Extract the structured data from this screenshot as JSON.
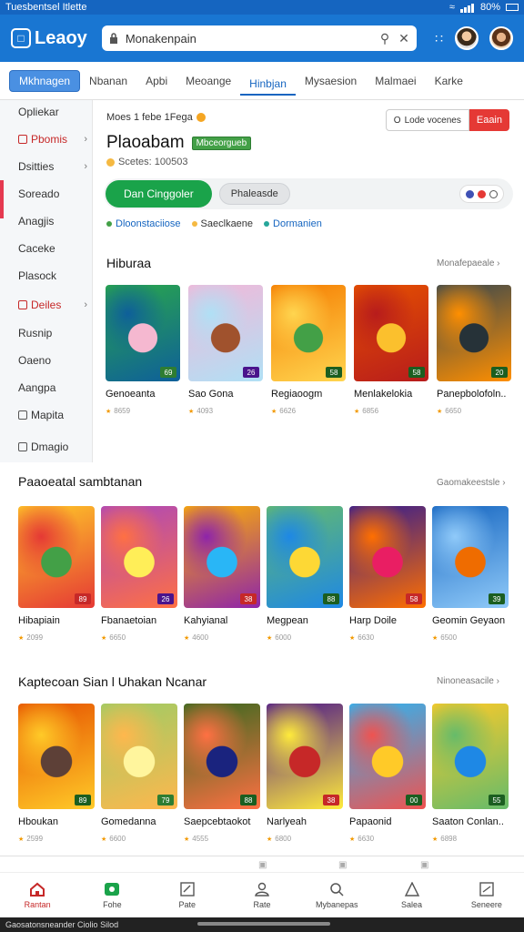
{
  "status_bar": {
    "left_text": "Tuesbentsel Itlette",
    "battery": "80%"
  },
  "header": {
    "logo_text": "Leaoy",
    "search_value": "Monakenpain"
  },
  "tabs": [
    "Mkhnagen",
    "Nbanan",
    "Apbi",
    "Meoange",
    "Hinbjan",
    "Mysaesion",
    "Malmaei",
    "Karke"
  ],
  "sidebar": {
    "items": [
      {
        "label": "Opliekar"
      },
      {
        "label": "Pbomis"
      },
      {
        "label": "Dsitties"
      },
      {
        "label": "Soreado"
      },
      {
        "label": "Anagjis"
      },
      {
        "label": "Caceke"
      },
      {
        "label": "Plasock"
      },
      {
        "label": "Deiles"
      },
      {
        "label": "Rusnip"
      },
      {
        "label": "Oaeno"
      },
      {
        "label": "Aangpa"
      },
      {
        "label": "Mapita"
      },
      {
        "label": "Dmagio"
      }
    ]
  },
  "top": {
    "info": "Moes 1 febe 1Fega",
    "title": "Plaoabam",
    "badge": "Mbceorgueb",
    "sub": "Scetes: 100503",
    "compare_label": "Lode vocenes",
    "compare_prefix": "O",
    "red_button": "Eaain",
    "primary_button": "Dan Cinggoler",
    "secondary_button": "Phaleasde",
    "legend": [
      "Dloonstaciiose",
      "Saeclkaene",
      "Dormanien"
    ]
  },
  "sections": [
    {
      "title": "Hiburaa",
      "more": "Monafepaeale",
      "cards": [
        {
          "name": "Genoeanta",
          "meta": "8659",
          "tag": "69",
          "tag_color": "#2e7d32",
          "colors": [
            "#2aa84a",
            "#0e5f9a",
            "#f5b8d0"
          ]
        },
        {
          "name": "Sao Gona",
          "meta": "4093",
          "tag": "26",
          "tag_color": "#4a148c",
          "colors": [
            "#f3b7d8",
            "#b0e0f5",
            "#a0522d"
          ]
        },
        {
          "name": "Regiaoogm",
          "meta": "6626",
          "tag": "58",
          "tag_color": "#1b5e20",
          "colors": [
            "#f57c00",
            "#ffd54f",
            "#43a047"
          ]
        },
        {
          "name": "Menlakelokia",
          "meta": "6856",
          "tag": "58",
          "tag_color": "#1b5e20",
          "colors": [
            "#e65100",
            "#b71c1c",
            "#fbc02d"
          ]
        },
        {
          "name": "Panepbolofoln..",
          "meta": "6650",
          "tag": "20",
          "tag_color": "#1b5e20",
          "colors": [
            "#37474f",
            "#ff8f00",
            "#263238"
          ]
        }
      ]
    },
    {
      "title": "Paaoeatal sambtanan",
      "more": "Gaomakeestsle",
      "cards": [
        {
          "name": "Hibapiain",
          "meta": "2099",
          "tag": "89",
          "tag_color": "#c62828",
          "colors": [
            "#ffca28",
            "#e53935",
            "#43a047"
          ]
        },
        {
          "name": "Fbanaetoian",
          "meta": "6650",
          "tag": "26",
          "tag_color": "#4a148c",
          "colors": [
            "#ab47bc",
            "#ff7043",
            "#ffee58"
          ]
        },
        {
          "name": "Kahyianal",
          "meta": "4600",
          "tag": "38",
          "tag_color": "#c62828",
          "colors": [
            "#ffb300",
            "#8e24aa",
            "#29b6f6"
          ]
        },
        {
          "name": "Megpean",
          "meta": "6000",
          "tag": "88",
          "tag_color": "#1b5e20",
          "colors": [
            "#66bb6a",
            "#1e88e5",
            "#fdd835"
          ]
        },
        {
          "name": "Harp Doile",
          "meta": "6630",
          "tag": "58",
          "tag_color": "#c62828",
          "colors": [
            "#311b92",
            "#ff6f00",
            "#e91e63"
          ]
        },
        {
          "name": "Geomin Geyaon",
          "meta": "6500",
          "tag": "39",
          "tag_color": "#1b5e20",
          "colors": [
            "#1565c0",
            "#90caf9",
            "#ef6c00"
          ]
        }
      ]
    },
    {
      "title": "Kaptecoan Sian l Uhakan Ncanar",
      "more": "Ninoneasacile",
      "cards": [
        {
          "name": "Hboukan",
          "meta": "2599",
          "tag": "89",
          "tag_color": "#1b5e20",
          "colors": [
            "#e65100",
            "#ffca28",
            "#5d4037"
          ]
        },
        {
          "name": "Gomedanna",
          "meta": "6600",
          "tag": "79",
          "tag_color": "#2e7d32",
          "colors": [
            "#9ccc65",
            "#ffb74d",
            "#fff59d"
          ]
        },
        {
          "name": "Saepcebtaokot",
          "meta": "4555",
          "tag": "88",
          "tag_color": "#1b5e20",
          "colors": [
            "#33691e",
            "#ff7043",
            "#1a237e"
          ]
        },
        {
          "name": "Narlyeah",
          "meta": "6800",
          "tag": "38",
          "tag_color": "#c62828",
          "colors": [
            "#4a148c",
            "#ffeb3b",
            "#c62828"
          ]
        },
        {
          "name": "Papaonid",
          "meta": "6630",
          "tag": "00",
          "tag_color": "#1b5e20",
          "colors": [
            "#29b6f6",
            "#ef5350",
            "#ffca28"
          ]
        },
        {
          "name": "Saaton Conlan..",
          "meta": "6898",
          "tag": "55",
          "tag_color": "#1b5e20",
          "colors": [
            "#ffca28",
            "#66bb6a",
            "#1e88e5"
          ]
        }
      ]
    }
  ],
  "bottom_nav": [
    {
      "label": "Rantan"
    },
    {
      "label": "Fohe"
    },
    {
      "label": "Pate"
    },
    {
      "label": "Rate"
    },
    {
      "label": "Mybanepas"
    },
    {
      "label": "Salea"
    },
    {
      "label": "Seneere"
    }
  ],
  "bottom_strip": {
    "text": "Gaosatonsneander Ciolio Silod"
  },
  "colors": {
    "header": "#1976d2",
    "accent_green": "#1aa34a",
    "accent_red": "#e53935",
    "status": "#1565c0"
  }
}
